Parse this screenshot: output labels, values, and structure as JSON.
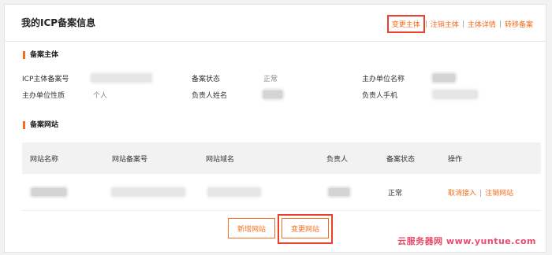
{
  "header": {
    "title": "我的ICP备案信息",
    "actions": [
      {
        "label": "变更主体",
        "highlighted": true
      },
      {
        "label": "注销主体"
      },
      {
        "label": "主体详情"
      },
      {
        "label": "转移备案"
      }
    ],
    "separator": "|"
  },
  "subject": {
    "section_title": "备案主体",
    "fields": {
      "icp_number_label": "ICP主体备案号",
      "status_label": "备案状态",
      "status_value": "正常",
      "org_name_label": "主办单位名称",
      "org_type_label": "主办单位性质",
      "org_type_value": "个人",
      "owner_name_label": "负责人姓名",
      "owner_phone_label": "负责人手机"
    }
  },
  "websites": {
    "section_title": "备案网站",
    "columns": [
      "网站名称",
      "网站备案号",
      "网站域名",
      "负责人",
      "备案状态",
      "操作"
    ],
    "rows": [
      {
        "status": "正常",
        "actions": [
          "取消接入",
          "注销网站"
        ]
      }
    ]
  },
  "buttons": {
    "add_site": "新增网站",
    "change_site": "变更网站"
  },
  "watermark": "云服务器网 www.yuntue.com",
  "colors": {
    "accent": "#f76c1c",
    "highlight_box": "#e8402c",
    "watermark": "#e94a6b"
  }
}
